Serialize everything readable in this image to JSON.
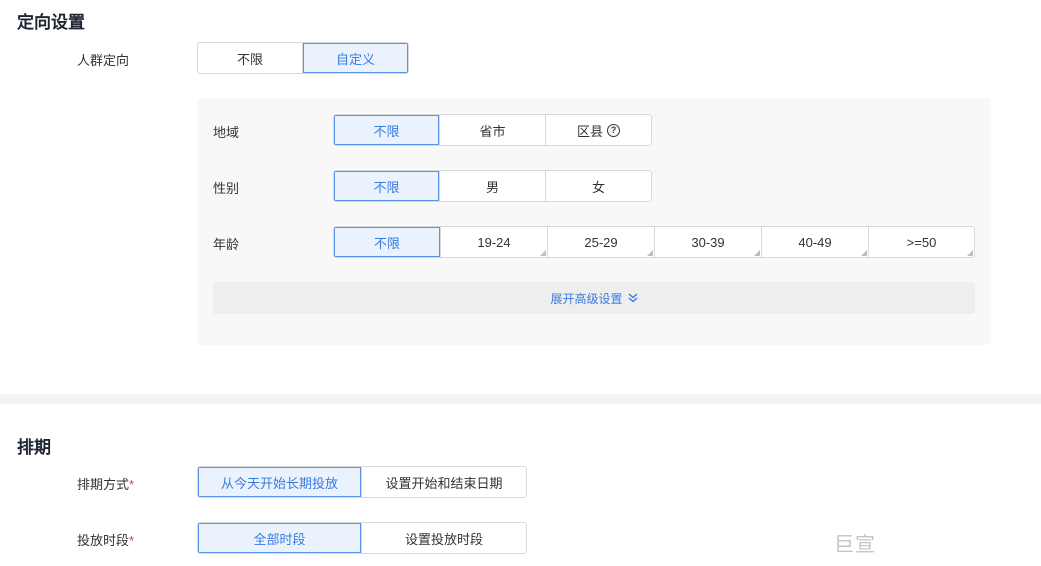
{
  "targeting": {
    "title": "定向设置",
    "crowd": {
      "label": "人群定向",
      "options": [
        "不限",
        "自定义"
      ],
      "selected": "自定义"
    },
    "region": {
      "label": "地域",
      "options": [
        "不限",
        "省市",
        "区县"
      ],
      "selected": "不限",
      "help_icon": "question-circle-icon"
    },
    "gender": {
      "label": "性别",
      "options": [
        "不限",
        "男",
        "女"
      ],
      "selected": "不限"
    },
    "age": {
      "label": "年龄",
      "options": [
        "不限",
        "19-24",
        "25-29",
        "30-39",
        "40-49",
        ">=50"
      ],
      "selected": "不限"
    },
    "expand_label": "展开高级设置",
    "expand_icon": "double-chevron-down-icon"
  },
  "schedule": {
    "title": "排期",
    "mode": {
      "label": "排期方式",
      "required_mark": "*",
      "options": [
        "从今天开始长期投放",
        "设置开始和结束日期"
      ],
      "selected": "从今天开始长期投放"
    },
    "time": {
      "label": "投放时段",
      "required_mark": "*",
      "options": [
        "全部时段",
        "设置投放时段"
      ],
      "selected": "全部时段"
    }
  },
  "watermark": "巨宣",
  "colors": {
    "accent": "#3a7be0",
    "active_bg": "#eaf2fd",
    "required": "#e4393c",
    "panel_bg": "#f8f8f8"
  }
}
